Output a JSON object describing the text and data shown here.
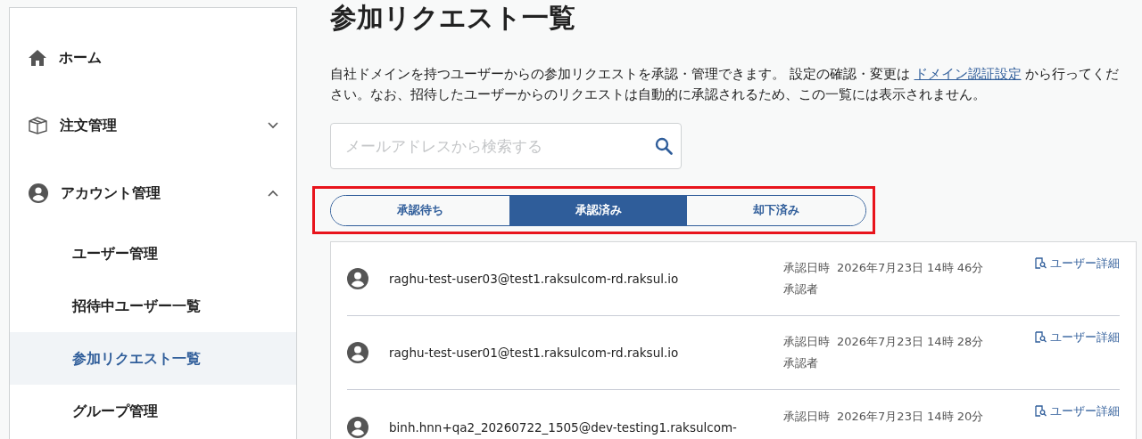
{
  "sidebar": {
    "items": [
      {
        "label": "ホーム",
        "kind": "home",
        "selected": false
      },
      {
        "label": "注文管理",
        "kind": "orders",
        "expanded": false,
        "selected": false
      },
      {
        "label": "アカウント管理",
        "kind": "account",
        "expanded": true,
        "selected": false,
        "children": [
          {
            "label": "ユーザー管理",
            "selected": false
          },
          {
            "label": "招待中ユーザー一覧",
            "selected": false
          },
          {
            "label": "参加リクエスト一覧",
            "selected": true
          },
          {
            "label": "グループ管理",
            "selected": false
          }
        ]
      }
    ]
  },
  "page": {
    "title": "参加リクエスト一覧",
    "description": {
      "before": "自社ドメインを持つユーザーからの参加リクエストを承認・管理できます。 設定の確認・変更は ",
      "link": "ドメイン認証設定",
      "after": " から行ってください。なお、招待したユーザーからのリクエストは自動的に承認されるため、この一覧には表示されません。"
    },
    "search": {
      "placeholder": "メールアドレスから検索する"
    },
    "tabs": [
      {
        "label": "承認待ち",
        "selected": false
      },
      {
        "label": "承認済み",
        "selected": true
      },
      {
        "label": "却下済み",
        "selected": false
      }
    ],
    "requests": [
      {
        "email": "raghu-test-user03@test1.raksulcom-rd.raksul.io",
        "approved_label": "承認日時",
        "approved_at": "2026年7月23日 14時 46分",
        "approver_label": "承認者",
        "detail_link": "ユーザー詳細"
      },
      {
        "email": "raghu-test-user01@test1.raksulcom-rd.raksul.io",
        "approved_label": "承認日時",
        "approved_at": "2026年7月23日 14時 28分",
        "approver_label": "承認者",
        "detail_link": "ユーザー詳細"
      },
      {
        "email": "binh.hnn+qa2_20260722_1505@dev-testing1.raksulcom-",
        "approved_label": "承認日時",
        "approved_at": "2026年7月23日 14時 20分",
        "detail_link": "ユーザー詳細"
      }
    ]
  }
}
